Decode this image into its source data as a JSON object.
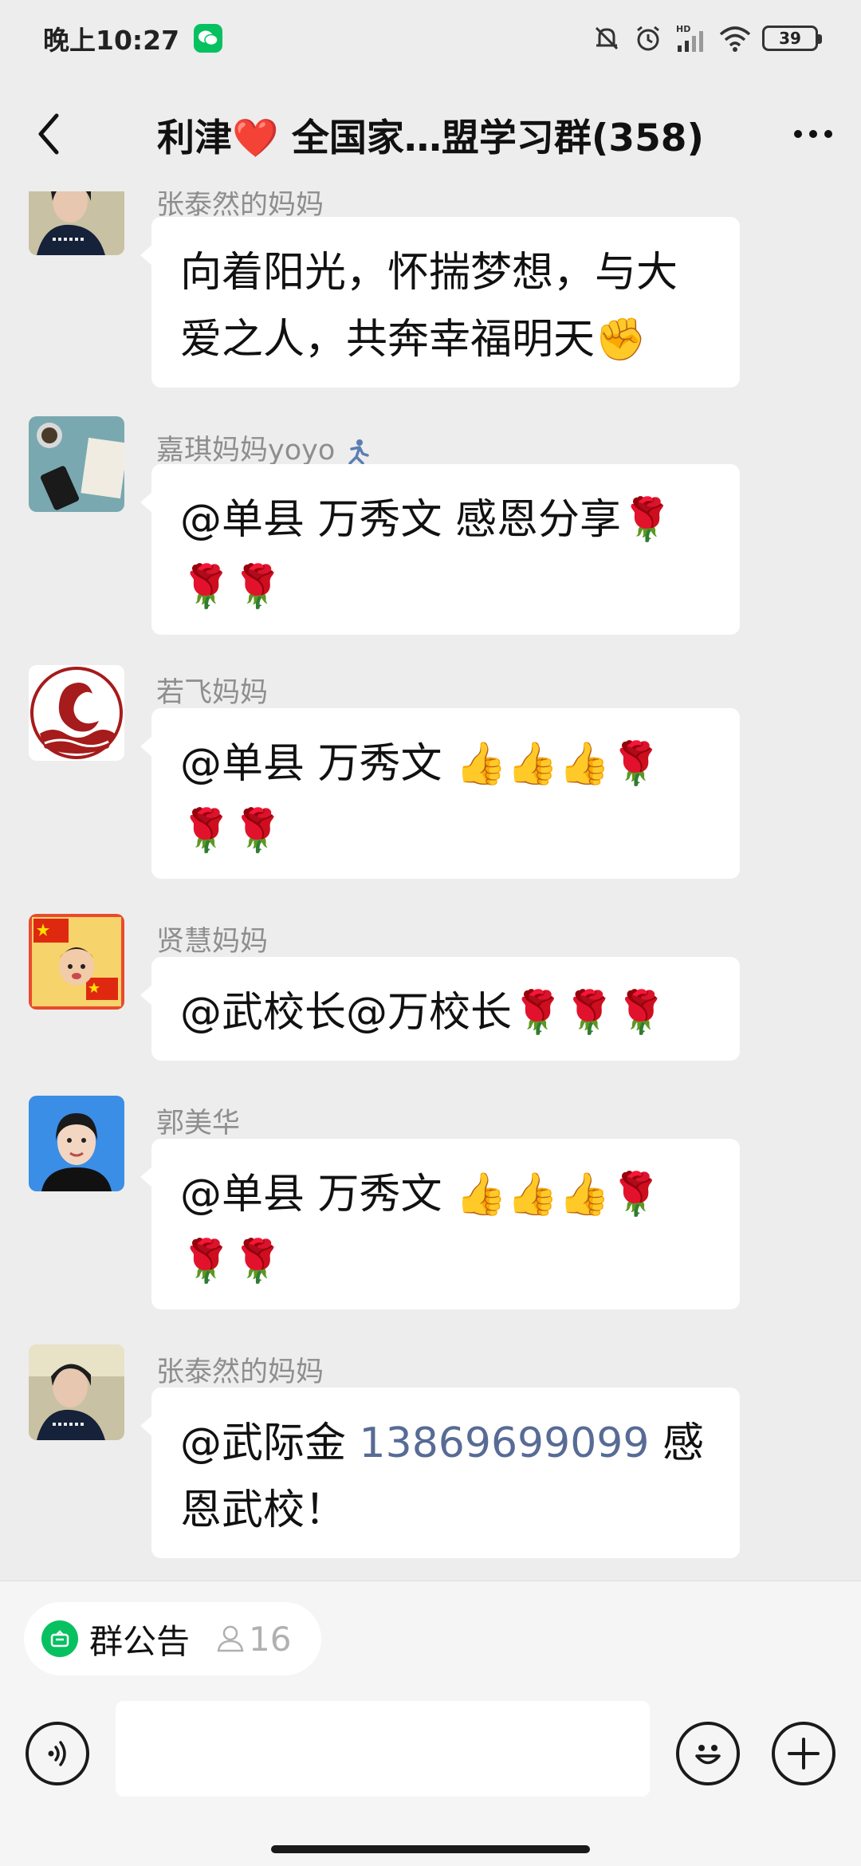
{
  "status_bar": {
    "time": "晚上10:27",
    "network_label": "HD",
    "battery_level": "39"
  },
  "header": {
    "title": "利津❤️ 全国家…盟学习群(358)"
  },
  "messages": [
    {
      "sender": "张泰然的妈妈",
      "text": "向着阳光，怀揣梦想，与大爱之人，共奔幸福明天✊"
    },
    {
      "sender": "嘉琪妈妈yoyo",
      "text": "@单县 万秀文  感恩分享🌹🌹🌹"
    },
    {
      "sender": "若飞妈妈",
      "text": "@单县 万秀文 👍👍👍🌹🌹🌹"
    },
    {
      "sender": "贤慧妈妈",
      "text": "@武校长@万校长🌹🌹🌹"
    },
    {
      "sender": "郭美华",
      "text": "@单县 万秀文 👍👍👍🌹🌹🌹"
    },
    {
      "sender": "张泰然的妈妈",
      "text_prefix": "@武际金 ",
      "phone": "13869699099",
      "text_suffix": " 感恩武校！"
    }
  ],
  "bottom": {
    "announcement_label": "群公告",
    "member_count": "16"
  },
  "colors": {
    "wechat_green": "#07c160",
    "link_blue": "#576b95",
    "chat_background": "#ededed"
  }
}
